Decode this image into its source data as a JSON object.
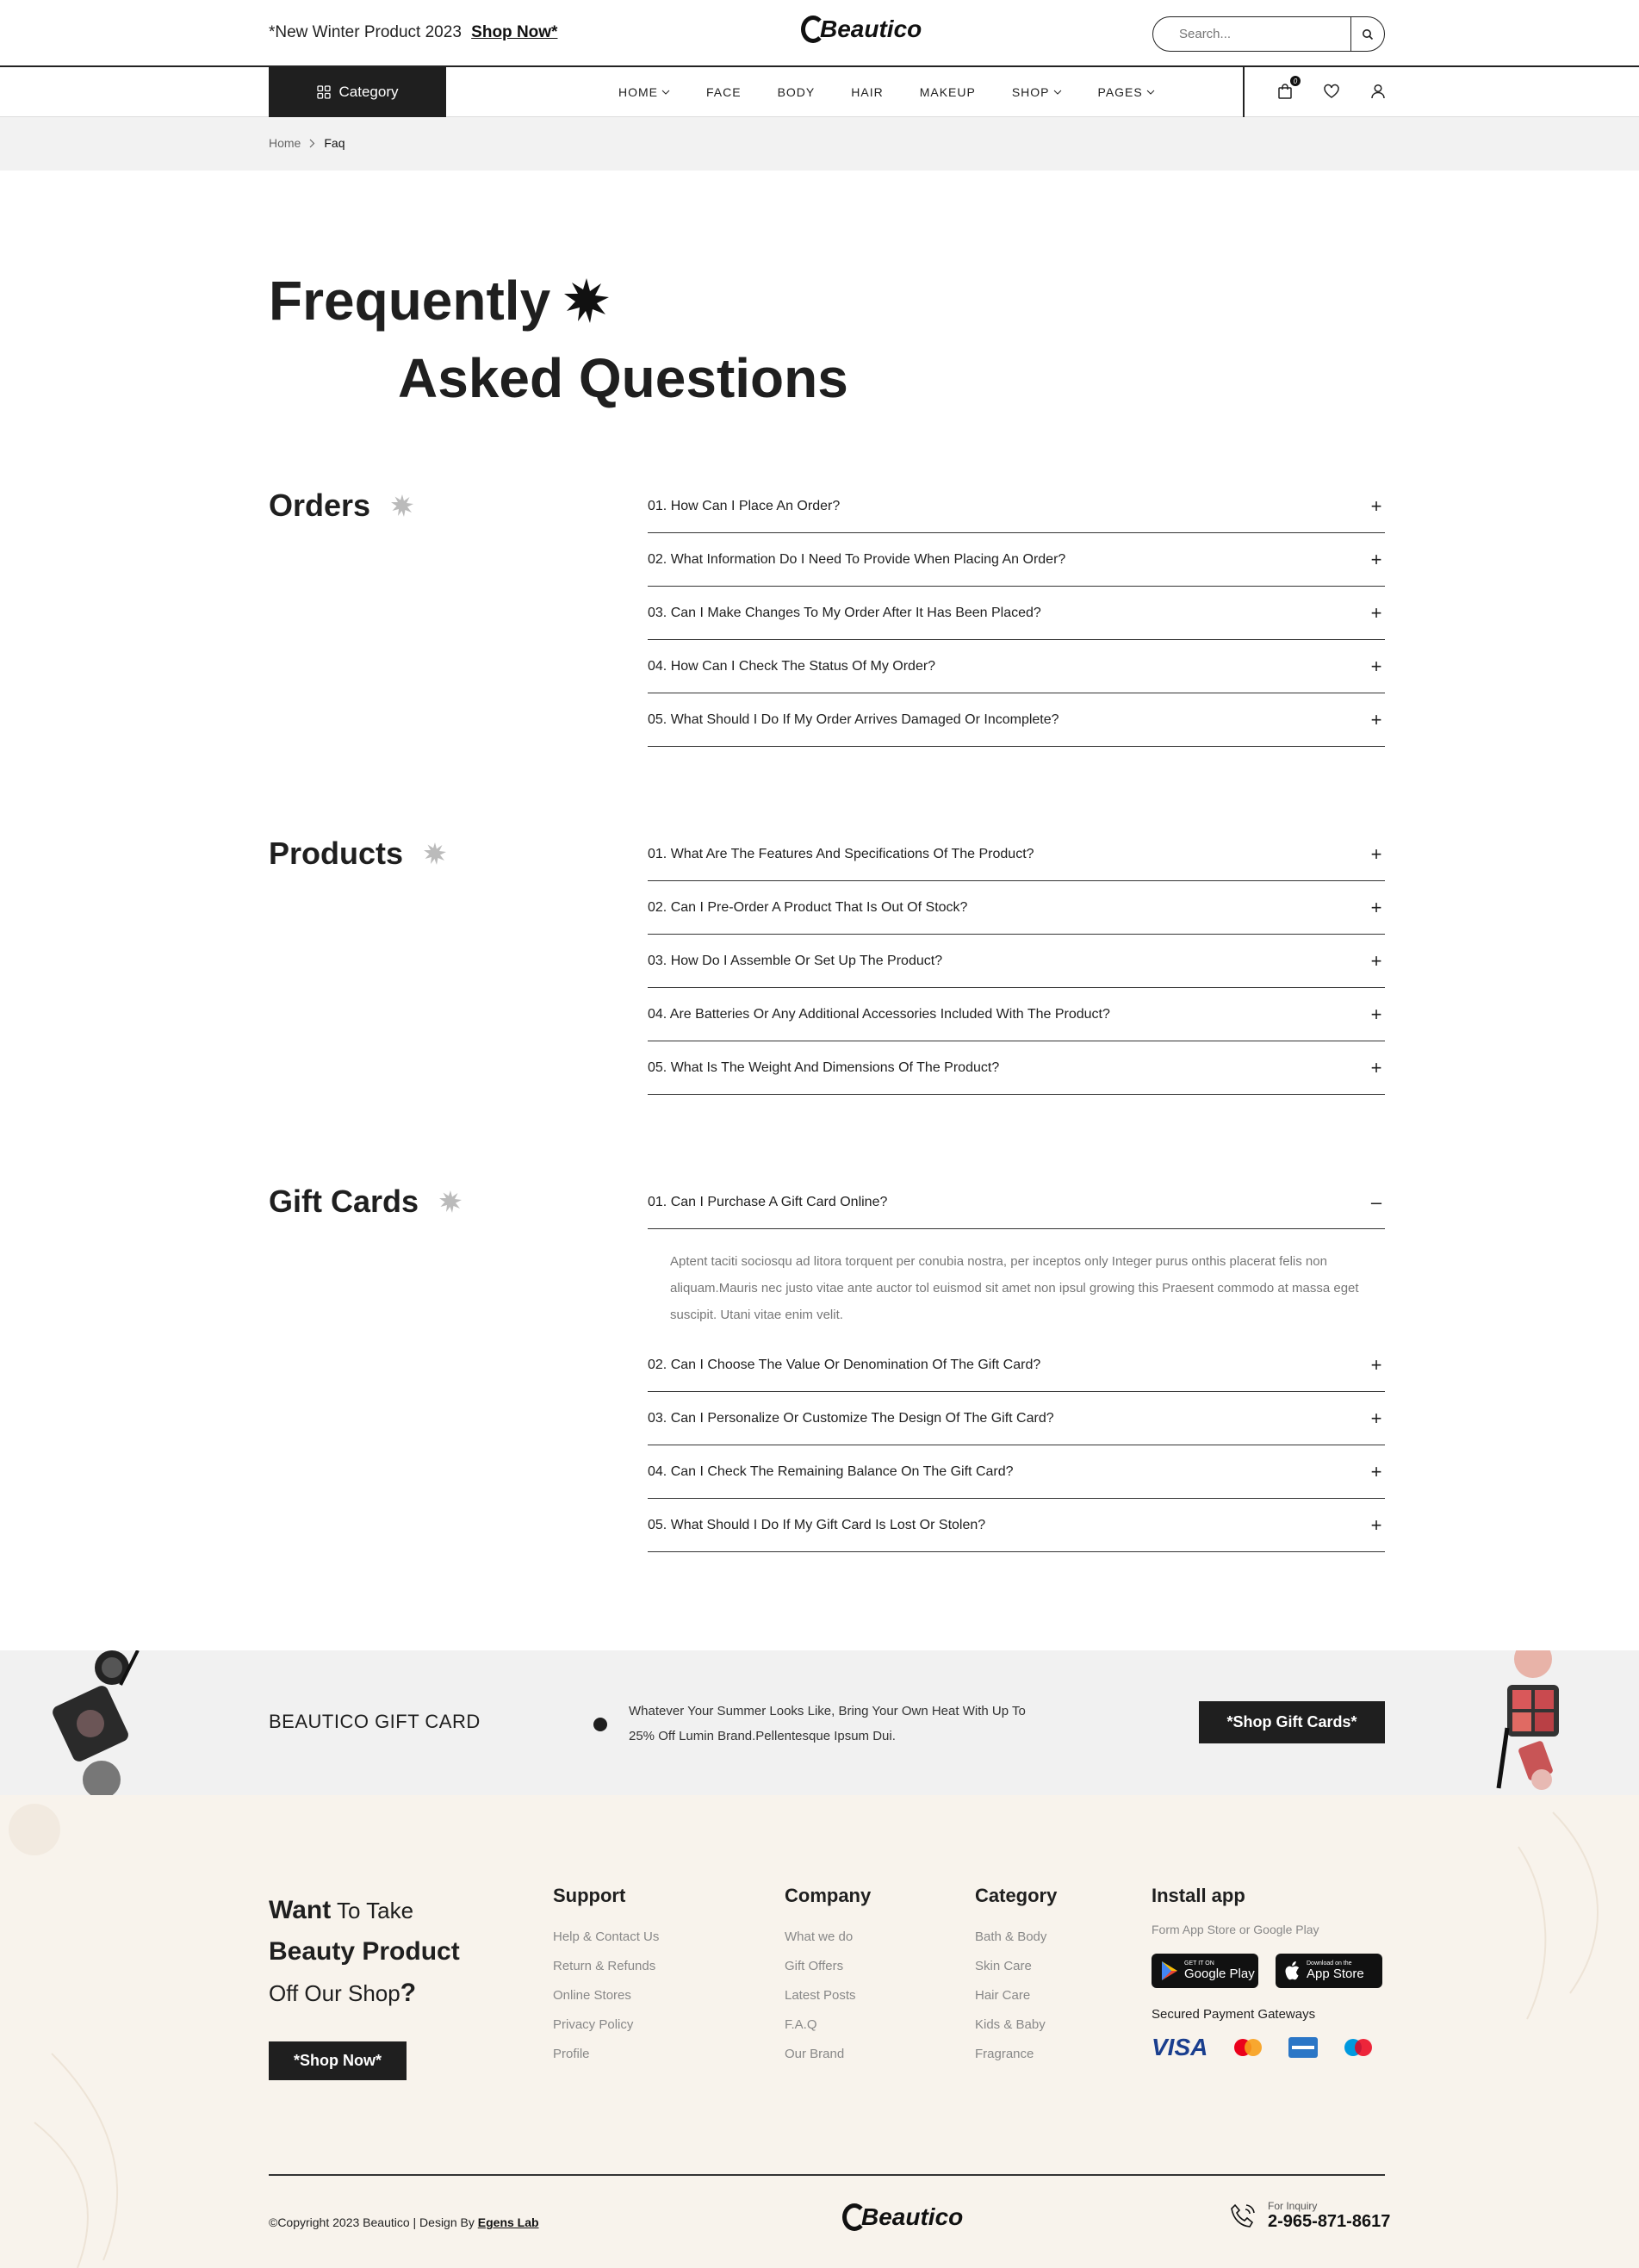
{
  "topbar": {
    "promo_text": "*New Winter Product 2023",
    "promo_link": "Shop Now*",
    "logo": "Beautico",
    "search_placeholder": "Search..."
  },
  "nav": {
    "category_label": "Category",
    "items": [
      {
        "label": "HOME",
        "dropdown": true
      },
      {
        "label": "FACE",
        "dropdown": false
      },
      {
        "label": "BODY",
        "dropdown": false
      },
      {
        "label": "HAIR",
        "dropdown": false
      },
      {
        "label": "MAKEUP",
        "dropdown": false
      },
      {
        "label": "SHOP",
        "dropdown": true
      },
      {
        "label": "PAGES",
        "dropdown": true
      }
    ],
    "cart_count": "0"
  },
  "breadcrumb": {
    "home": "Home",
    "current": "Faq"
  },
  "title": {
    "line1": "Frequently",
    "line2": "Asked Questions"
  },
  "sections": [
    {
      "title": "Orders",
      "questions": [
        {
          "q": "01. How Can I Place An Order?",
          "open": false
        },
        {
          "q": "02. What Information Do I Need To Provide When Placing An Order?",
          "open": false
        },
        {
          "q": "03. Can I Make Changes To My Order After It Has Been Placed?",
          "open": false
        },
        {
          "q": "04. How Can I Check The Status Of My Order?",
          "open": false
        },
        {
          "q": "05. What Should I Do If My Order Arrives Damaged Or Incomplete?",
          "open": false
        }
      ]
    },
    {
      "title": "Products",
      "questions": [
        {
          "q": "01. What Are The Features And Specifications Of The Product?",
          "open": false
        },
        {
          "q": "02. Can I Pre-Order A Product That Is Out Of Stock?",
          "open": false
        },
        {
          "q": "03. How Do I Assemble Or Set Up The Product?",
          "open": false
        },
        {
          "q": "04. Are Batteries Or Any Additional Accessories Included With The Product?",
          "open": false
        },
        {
          "q": "05. What Is The Weight And Dimensions Of The Product?",
          "open": false
        }
      ]
    },
    {
      "title": "Gift Cards",
      "questions": [
        {
          "q": "01. Can I Purchase A Gift Card Online?",
          "open": true,
          "answer": "Aptent taciti sociosqu ad litora torquent per conubia nostra, per inceptos only Integer purus onthis placerat felis non aliquam.Mauris nec justo vitae ante auctor tol euismod sit amet non ipsul growing this Praesent commodo at massa eget suscipit. Utani vitae enim velit."
        },
        {
          "q": "02. Can I Choose The Value Or Denomination Of The Gift Card?",
          "open": false
        },
        {
          "q": "03. Can I Personalize Or Customize The Design Of The Gift Card?",
          "open": false
        },
        {
          "q": "04. Can I Check The Remaining Balance On The Gift Card?",
          "open": false
        },
        {
          "q": "05. What Should I Do If My Gift Card Is Lost Or Stolen?",
          "open": false
        }
      ]
    }
  ],
  "gift_banner": {
    "title": "BEAUTICO GIFT CARD",
    "text": "Whatever Your Summer Looks Like, Bring Your Own Heat With Up To 25% Off Lumin Brand.Pellentesque Ipsum Dui.",
    "button": "*Shop Gift Cards*"
  },
  "footer": {
    "want_1": "Want",
    "want_2": "To Take",
    "want_3": "Beauty Product",
    "want_4": "Off Our Shop",
    "want_q": "?",
    "shop_now": "*Shop Now*",
    "columns": [
      {
        "title": "Support",
        "links": [
          "Help & Contact Us",
          "Return & Refunds",
          "Online Stores",
          "Privacy Policy",
          "Profile"
        ]
      },
      {
        "title": "Company",
        "links": [
          "What we do",
          "Gift Offers",
          "Latest Posts",
          "F.A.Q",
          "Our Brand"
        ]
      },
      {
        "title": "Category",
        "links": [
          "Bath & Body",
          "Skin Care",
          "Hair Care",
          "Kids & Baby",
          "Fragrance"
        ]
      }
    ],
    "install": {
      "title": "Install app",
      "sub": "Form App Store or Google Play",
      "google_small": "GET IT ON",
      "google_big": "Google Play",
      "apple_small": "Download on the",
      "apple_big": "App Store",
      "secured": "Secured Payment Gateways",
      "visa": "VISA"
    },
    "copyright": "©Copyright 2023 Beautico | Design By",
    "designer": "Egens Lab",
    "logo": "Beautico",
    "inquiry_label": "For Inquiry",
    "phone": "2-965-871-8617"
  }
}
